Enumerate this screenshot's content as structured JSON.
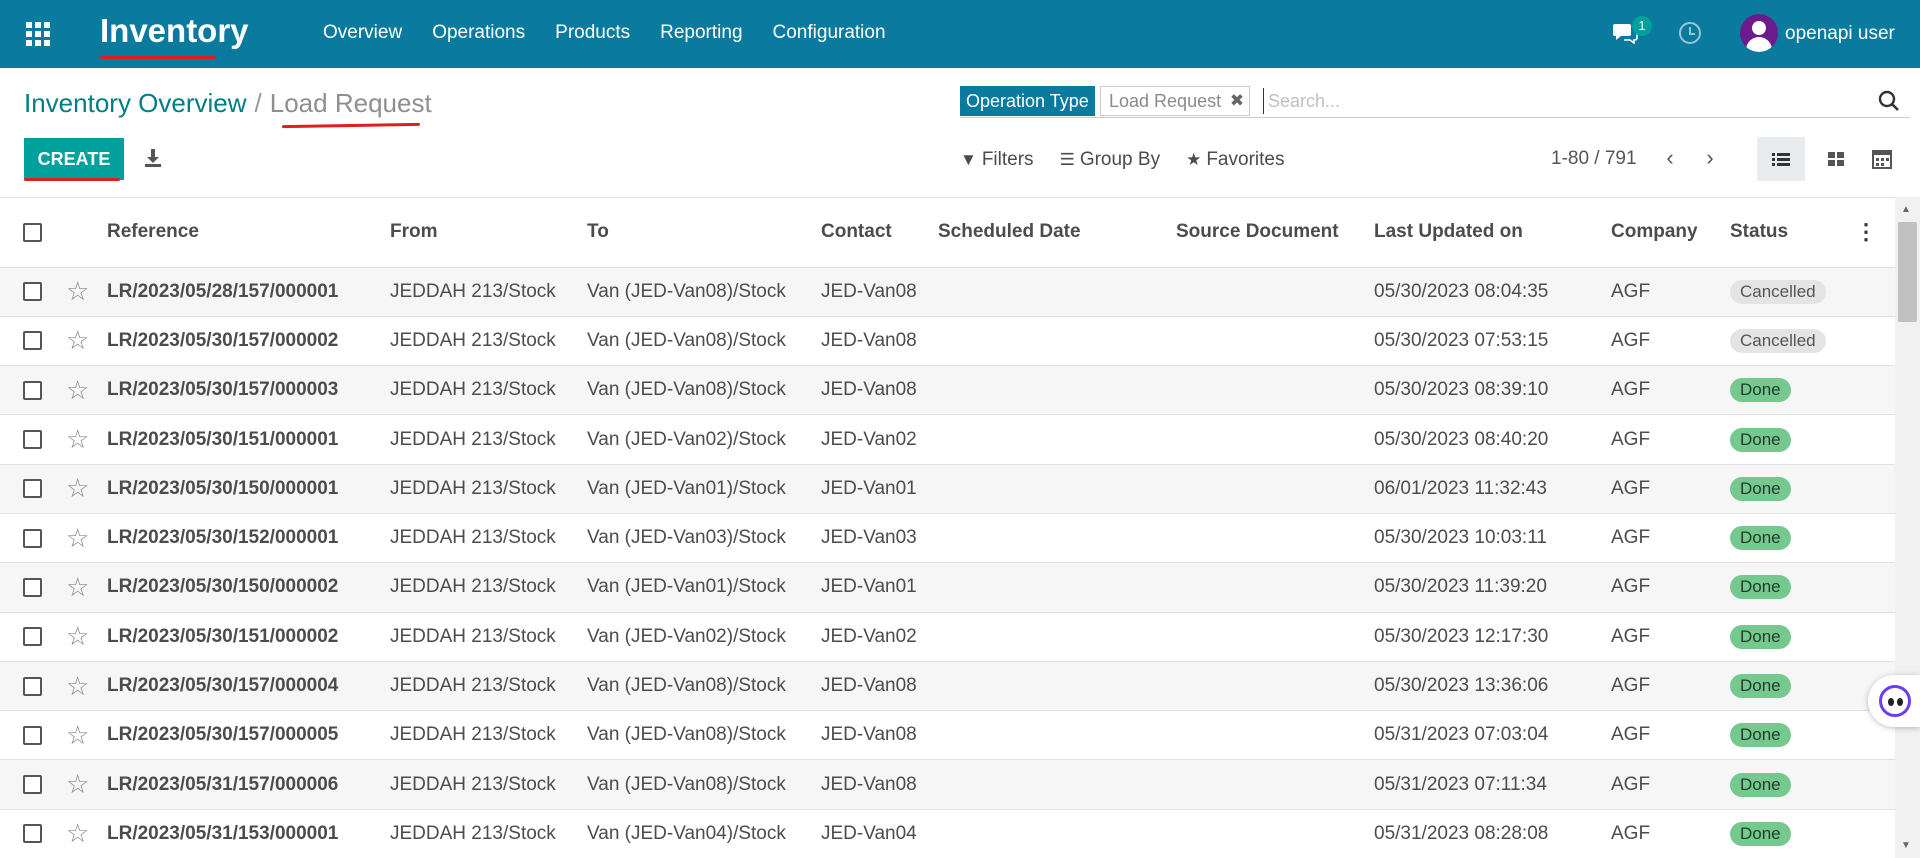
{
  "navbar": {
    "app_name": "Inventory",
    "menu": [
      "Overview",
      "Operations",
      "Products",
      "Reporting",
      "Configuration"
    ],
    "chat_count": "1",
    "user_name": "openapi user",
    "colors": {
      "bar": "#0b7a9f",
      "accent": "#00a09d"
    }
  },
  "breadcrumb": {
    "parent": "Inventory Overview",
    "separator": "/",
    "current": "Load Request"
  },
  "actions": {
    "create_label": "CREATE"
  },
  "search": {
    "facet_label": "Operation Type",
    "facet_value": "Load Request",
    "placeholder": "Search..."
  },
  "filters": {
    "filters_label": "Filters",
    "groupby_label": "Group By",
    "favorites_label": "Favorites"
  },
  "pager": {
    "range": "1-80 / 791"
  },
  "table": {
    "columns": [
      "Reference",
      "From",
      "To",
      "Contact",
      "Scheduled Date",
      "Source Document",
      "Last Updated on",
      "Company",
      "Status"
    ],
    "rows": [
      {
        "ref": "LR/2023/05/28/157/000001",
        "from": "JEDDAH 213/Stock",
        "to": "Van (JED-Van08)/Stock",
        "contact": "JED-Van08",
        "scheduled": "",
        "source": "",
        "updated": "05/30/2023 08:04:35",
        "company": "AGF",
        "status": "Cancelled"
      },
      {
        "ref": "LR/2023/05/30/157/000002",
        "from": "JEDDAH 213/Stock",
        "to": "Van (JED-Van08)/Stock",
        "contact": "JED-Van08",
        "scheduled": "",
        "source": "",
        "updated": "05/30/2023 07:53:15",
        "company": "AGF",
        "status": "Cancelled"
      },
      {
        "ref": "LR/2023/05/30/157/000003",
        "from": "JEDDAH 213/Stock",
        "to": "Van (JED-Van08)/Stock",
        "contact": "JED-Van08",
        "scheduled": "",
        "source": "",
        "updated": "05/30/2023 08:39:10",
        "company": "AGF",
        "status": "Done"
      },
      {
        "ref": "LR/2023/05/30/151/000001",
        "from": "JEDDAH 213/Stock",
        "to": "Van (JED-Van02)/Stock",
        "contact": "JED-Van02",
        "scheduled": "",
        "source": "",
        "updated": "05/30/2023 08:40:20",
        "company": "AGF",
        "status": "Done"
      },
      {
        "ref": "LR/2023/05/30/150/000001",
        "from": "JEDDAH 213/Stock",
        "to": "Van (JED-Van01)/Stock",
        "contact": "JED-Van01",
        "scheduled": "",
        "source": "",
        "updated": "06/01/2023 11:32:43",
        "company": "AGF",
        "status": "Done"
      },
      {
        "ref": "LR/2023/05/30/152/000001",
        "from": "JEDDAH 213/Stock",
        "to": "Van (JED-Van03)/Stock",
        "contact": "JED-Van03",
        "scheduled": "",
        "source": "",
        "updated": "05/30/2023 10:03:11",
        "company": "AGF",
        "status": "Done"
      },
      {
        "ref": "LR/2023/05/30/150/000002",
        "from": "JEDDAH 213/Stock",
        "to": "Van (JED-Van01)/Stock",
        "contact": "JED-Van01",
        "scheduled": "",
        "source": "",
        "updated": "05/30/2023 11:39:20",
        "company": "AGF",
        "status": "Done"
      },
      {
        "ref": "LR/2023/05/30/151/000002",
        "from": "JEDDAH 213/Stock",
        "to": "Van (JED-Van02)/Stock",
        "contact": "JED-Van02",
        "scheduled": "",
        "source": "",
        "updated": "05/30/2023 12:17:30",
        "company": "AGF",
        "status": "Done"
      },
      {
        "ref": "LR/2023/05/30/157/000004",
        "from": "JEDDAH 213/Stock",
        "to": "Van (JED-Van08)/Stock",
        "contact": "JED-Van08",
        "scheduled": "",
        "source": "",
        "updated": "05/30/2023 13:36:06",
        "company": "AGF",
        "status": "Done"
      },
      {
        "ref": "LR/2023/05/30/157/000005",
        "from": "JEDDAH 213/Stock",
        "to": "Van (JED-Van08)/Stock",
        "contact": "JED-Van08",
        "scheduled": "",
        "source": "",
        "updated": "05/31/2023 07:03:04",
        "company": "AGF",
        "status": "Done"
      },
      {
        "ref": "LR/2023/05/31/157/000006",
        "from": "JEDDAH 213/Stock",
        "to": "Van (JED-Van08)/Stock",
        "contact": "JED-Van08",
        "scheduled": "",
        "source": "",
        "updated": "05/31/2023 07:11:34",
        "company": "AGF",
        "status": "Done"
      },
      {
        "ref": "LR/2023/05/31/153/000001",
        "from": "JEDDAH 213/Stock",
        "to": "Van (JED-Van04)/Stock",
        "contact": "JED-Van04",
        "scheduled": "",
        "source": "",
        "updated": "05/31/2023 08:28:08",
        "company": "AGF",
        "status": "Done"
      }
    ]
  }
}
